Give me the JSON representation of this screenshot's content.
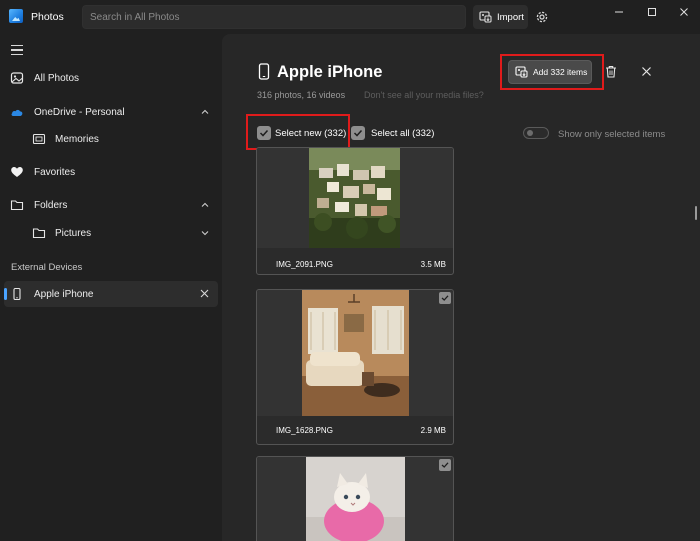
{
  "window": {
    "app_title": "Photos",
    "search_placeholder": "Search in All Photos",
    "import_label": "Import"
  },
  "sidebar": {
    "items": [
      {
        "label": "All Photos",
        "icon": "photo-icon"
      },
      {
        "label": "OneDrive - Personal",
        "icon": "cloud-icon"
      },
      {
        "label": "Memories",
        "icon": "memories-icon"
      },
      {
        "label": "Favorites",
        "icon": "heart-icon"
      },
      {
        "label": "Folders",
        "icon": "folder-icon"
      },
      {
        "label": "Pictures",
        "icon": "folder-icon"
      }
    ],
    "section_label": "External Devices",
    "device_item": "Apple iPhone"
  },
  "main": {
    "device_title": "Apple iPhone",
    "subtitle": "316 photos, 16 videos",
    "subtitle_link": "Don't see all your media files?",
    "add_label": "Add 332 items",
    "select_new_label": "Select new (332)",
    "select_all_label": "Select all (332)",
    "toggle_label": "Show only selected items",
    "photos": [
      {
        "name": "IMG_2091.PNG",
        "size": "3.5 MB",
        "subject": "hillside village"
      },
      {
        "name": "IMG_1628.PNG",
        "size": "2.9 MB",
        "subject": "living room"
      },
      {
        "name": "",
        "size": "",
        "subject": "white kitten"
      }
    ]
  },
  "colors": {
    "highlight": "#e01b1b",
    "accent": "#4aa3ff",
    "background": "#202020",
    "pane": "#272727"
  }
}
